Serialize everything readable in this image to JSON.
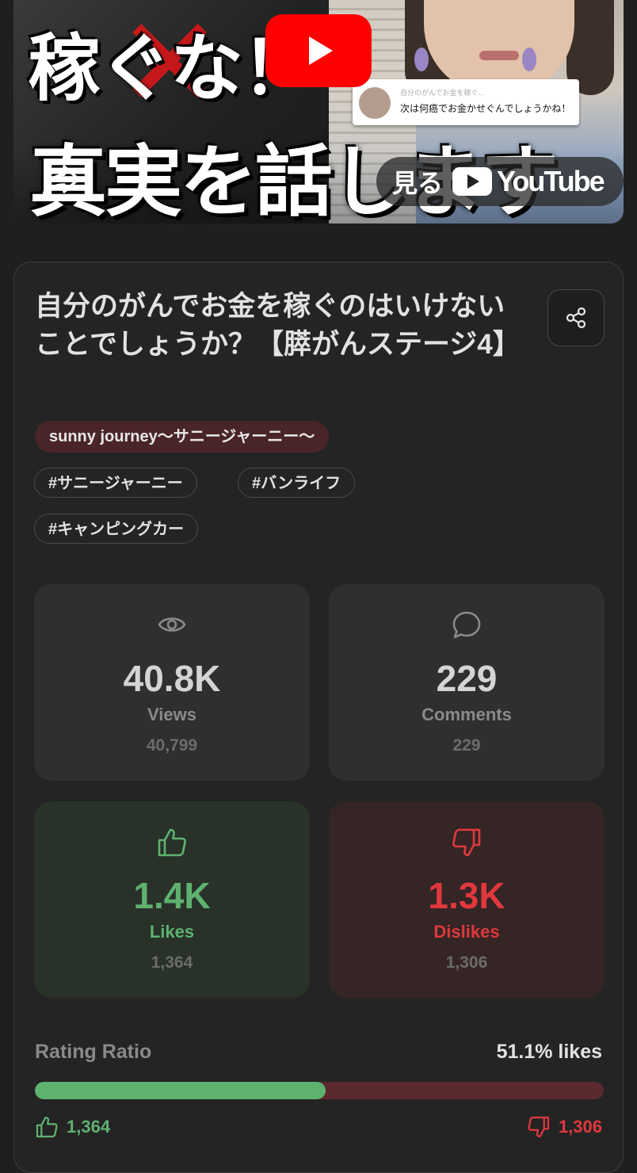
{
  "thumbnail": {
    "title_line1": "稼ぐな！",
    "title_line2": "真実を話します",
    "comment_meta": "自分のがんでお金を稼ぐ...",
    "comment_text": "次は何癌でお金かせぐんでしょうかね！",
    "watch_on_label": "見る",
    "youtube_word": "YouTube",
    "brand_red": "#ff0000"
  },
  "video": {
    "title": "自分のがんでお金を稼ぐのはいけないことでしょうか？【膵がんステージ4】",
    "channel": "sunny journey〜サニージャーニー〜",
    "tags": [
      "#サニージャーニー",
      "#バンライフ",
      "#キャンピングカー"
    ]
  },
  "stats": {
    "views": {
      "short": "40.8K",
      "label": "Views",
      "exact": "40,799",
      "icon": "eye-icon"
    },
    "comments": {
      "short": "229",
      "label": "Comments",
      "exact": "229",
      "icon": "comment-icon"
    },
    "likes": {
      "short": "1.4K",
      "label": "Likes",
      "exact": "1,364",
      "icon": "thumbs-up-icon",
      "color": "#5fb170"
    },
    "dislikes": {
      "short": "1.3K",
      "label": "Dislikes",
      "exact": "1,306",
      "icon": "thumbs-down-icon",
      "color": "#e0383e"
    }
  },
  "rating": {
    "label": "Rating Ratio",
    "percent_text": "51.1% likes",
    "like_fraction": 0.511,
    "likes": "1,364",
    "dislikes": "1,306"
  }
}
